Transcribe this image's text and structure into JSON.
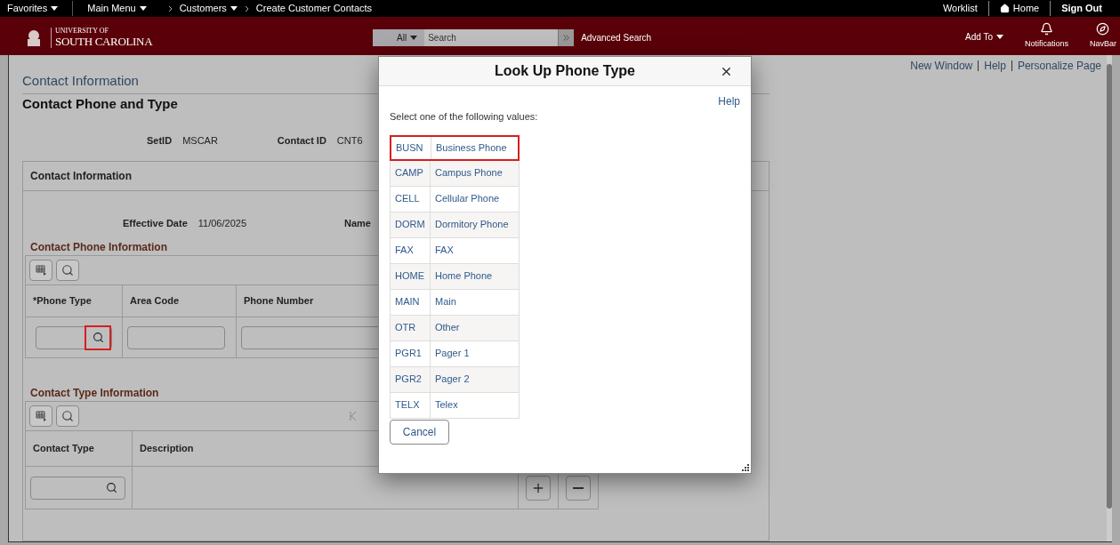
{
  "top_bar": {
    "menus": [
      {
        "label": "Favorites",
        "dropdown": true
      },
      {
        "label": "Main Menu",
        "dropdown": true
      }
    ],
    "breadcrumbs": [
      {
        "label": "Customers",
        "dropdown": true
      },
      {
        "label": "Create Customer Contacts",
        "dropdown": false
      }
    ],
    "right_links": [
      {
        "kind": "text",
        "label": "Worklist"
      },
      {
        "kind": "home",
        "label": "Home"
      },
      {
        "kind": "bold",
        "label": "Sign Out"
      }
    ]
  },
  "header": {
    "logo_small": "UNIVERSITY OF",
    "logo_large": "SOUTH CAROLINA",
    "search_scope": "All",
    "search_placeholder": "Search",
    "advanced_search": "Advanced Search",
    "add_to": "Add To",
    "notifications": "Notifications",
    "navbar": "NavBar"
  },
  "page_links": [
    "New Window",
    "Help",
    "Personalize Page"
  ],
  "page": {
    "breadcrumb_title": "Contact Information",
    "title": "Contact Phone and Type",
    "key_fields": [
      {
        "label": "SetID",
        "value": "MSCAR"
      },
      {
        "label": "Contact ID",
        "value": "CNT6"
      }
    ],
    "section_title": "Contact Information",
    "effective_date": {
      "label": "Effective Date",
      "value": "11/06/2025"
    },
    "name_label": "Name",
    "phone_section": {
      "title": "Contact Phone Information",
      "columns": [
        "*Phone Type",
        "Area Code",
        "Phone Number"
      ],
      "lookup_highlighted": true
    },
    "type_section": {
      "title": "Contact Type Information",
      "columns": [
        "Contact Type",
        "Description"
      ]
    }
  },
  "modal": {
    "title": "Look Up Phone Type",
    "help": "Help",
    "instruction": "Select one of the following values:",
    "rows": [
      {
        "code": "BUSN",
        "description": "Business Phone",
        "highlighted": true
      },
      {
        "code": "CAMP",
        "description": "Campus Phone",
        "highlighted": false
      },
      {
        "code": "CELL",
        "description": "Cellular Phone",
        "highlighted": false
      },
      {
        "code": "DORM",
        "description": "Dormitory Phone",
        "highlighted": false
      },
      {
        "code": "FAX",
        "description": "FAX",
        "highlighted": false
      },
      {
        "code": "HOME",
        "description": "Home Phone",
        "highlighted": false
      },
      {
        "code": "MAIN",
        "description": "Main",
        "highlighted": false
      },
      {
        "code": "OTR",
        "description": "Other",
        "highlighted": false
      },
      {
        "code": "PGR1",
        "description": "Pager 1",
        "highlighted": false
      },
      {
        "code": "PGR2",
        "description": "Pager 2",
        "highlighted": false
      },
      {
        "code": "TELX",
        "description": "Telex",
        "highlighted": false
      }
    ],
    "cancel": "Cancel"
  }
}
